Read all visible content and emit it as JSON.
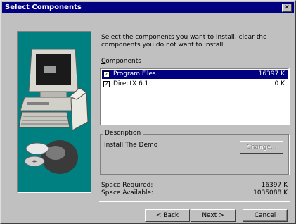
{
  "window": {
    "title": "Select Components"
  },
  "instructions": "Select the components you want to install, clear the components you do not want to install.",
  "components": {
    "label_prefix": "C",
    "label_rest": "omponents",
    "items": [
      {
        "name": "Program Files",
        "size": "16397 K",
        "checked": true,
        "selected": true
      },
      {
        "name": "DirectX 6.1",
        "size": "0 K",
        "checked": true,
        "selected": false
      }
    ]
  },
  "description": {
    "label": "Description",
    "text": "Install The Demo",
    "change_label": "Change..."
  },
  "space": {
    "required_label": "Space Required:",
    "required_value": "16397 K",
    "available_label": "Space Available:",
    "available_value": "1035088 K"
  },
  "buttons": {
    "back_prefix": "< ",
    "back_key": "B",
    "back_rest": "ack",
    "next_key": "N",
    "next_rest": "ext >",
    "cancel": "Cancel"
  },
  "colors": {
    "titlebar": "#000080",
    "face": "#c0c0c0",
    "art_bg": "#008080"
  }
}
